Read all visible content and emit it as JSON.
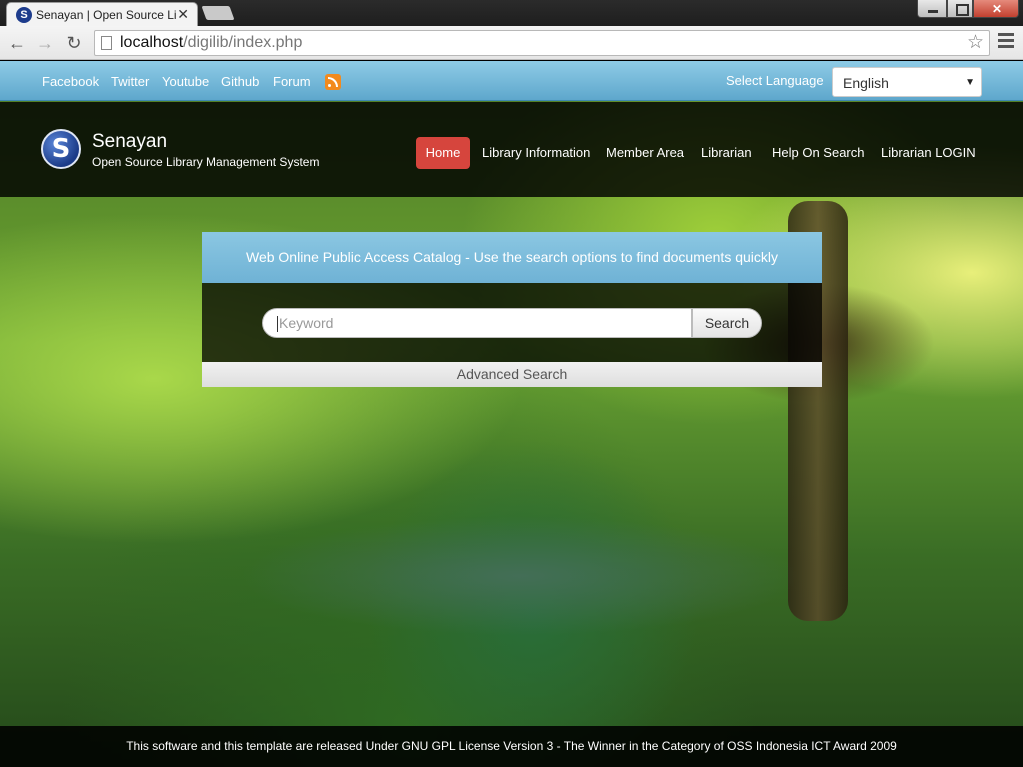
{
  "browser": {
    "tab_title": "Senayan | Open Source Lib",
    "url_host": "localhost",
    "url_path": "/digilib/index.php"
  },
  "topbar": {
    "social": [
      {
        "label": "Facebook"
      },
      {
        "label": "Twitter"
      },
      {
        "label": "Youtube"
      },
      {
        "label": "Github"
      },
      {
        "label": "Forum"
      }
    ],
    "rss_icon": "rss-icon",
    "language_label": "Select Language",
    "language_value": "English"
  },
  "header": {
    "brand_name": "Senayan",
    "brand_subtitle": "Open Source Library Management System",
    "nav": [
      {
        "label": "Home",
        "active": true
      },
      {
        "label": "Library Information"
      },
      {
        "label": "Member Area"
      },
      {
        "label": "Librarian"
      },
      {
        "label": "Help On Search"
      },
      {
        "label": "Librarian LOGIN"
      }
    ],
    "active_color": "#d6453d"
  },
  "search": {
    "heading": "Web Online Public Access Catalog - Use the search options to find documents quickly",
    "placeholder": "Keyword",
    "button": "Search",
    "advanced": "Advanced Search"
  },
  "footer": {
    "text": "This software and this template are released Under GNU GPL License Version 3 - The Winner in the Category of OSS Indonesia ICT Award 2009"
  }
}
